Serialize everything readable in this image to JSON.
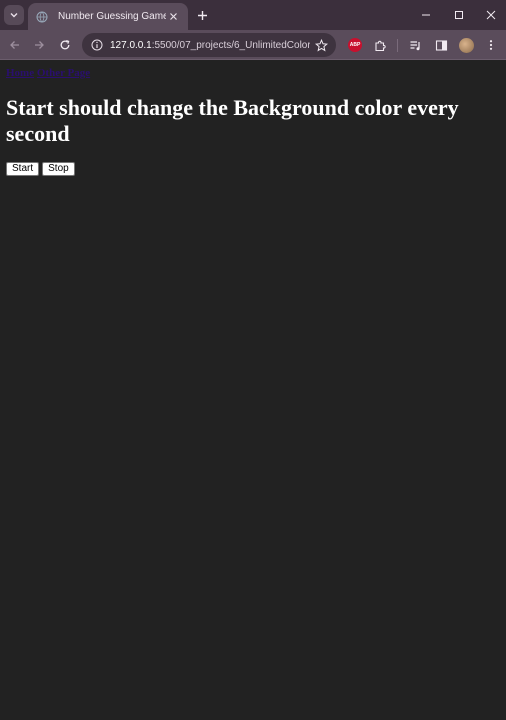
{
  "browser": {
    "tab": {
      "title": "Number Guessing Game"
    },
    "address": {
      "host": "127.0.0.1",
      "path": ":5500/07_projects/6_UnlimitedColor..."
    },
    "extensions": {
      "abp_label": "ABP"
    }
  },
  "page": {
    "nav": {
      "home": "Home",
      "other": "Other Page"
    },
    "heading": "Start should change the Background color every second",
    "buttons": {
      "start": "Start",
      "stop": "Stop"
    }
  },
  "colors": {
    "page_background": "#222222",
    "tab_strip": "#3b2f3c",
    "toolbar": "#5a4c5b",
    "link": "#2a0f6e"
  }
}
